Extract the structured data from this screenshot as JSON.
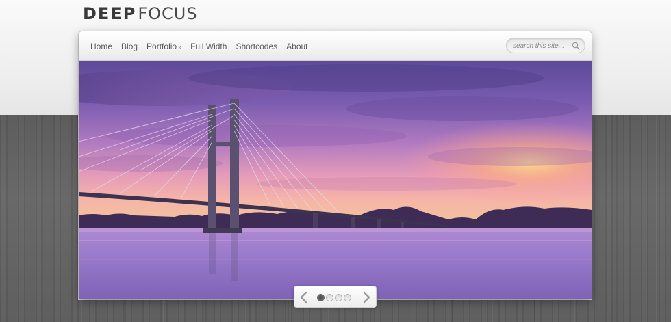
{
  "site": {
    "logo_left": "DEEP",
    "logo_right": "FOCUS"
  },
  "nav": {
    "items": [
      {
        "label": "Home",
        "has_submenu": false
      },
      {
        "label": "Blog",
        "has_submenu": false
      },
      {
        "label": "Portfolio",
        "has_submenu": true
      },
      {
        "label": "Full Width",
        "has_submenu": false
      },
      {
        "label": "Shortcodes",
        "has_submenu": false
      },
      {
        "label": "About",
        "has_submenu": false
      }
    ],
    "submenu_indicator": "»"
  },
  "search": {
    "placeholder": "search this site...",
    "value": "",
    "icon": "magnifier-icon"
  },
  "slider": {
    "slide_count": 4,
    "active_index": 0,
    "prev_icon": "chevron-left-icon",
    "next_icon": "chevron-right-icon"
  },
  "colors": {
    "logo": "#3a3a3a",
    "nav_text": "#5a5a5a",
    "sky_top": "#6b58a8",
    "sunset": "#f0a0a8",
    "water": "#9a78c8"
  }
}
